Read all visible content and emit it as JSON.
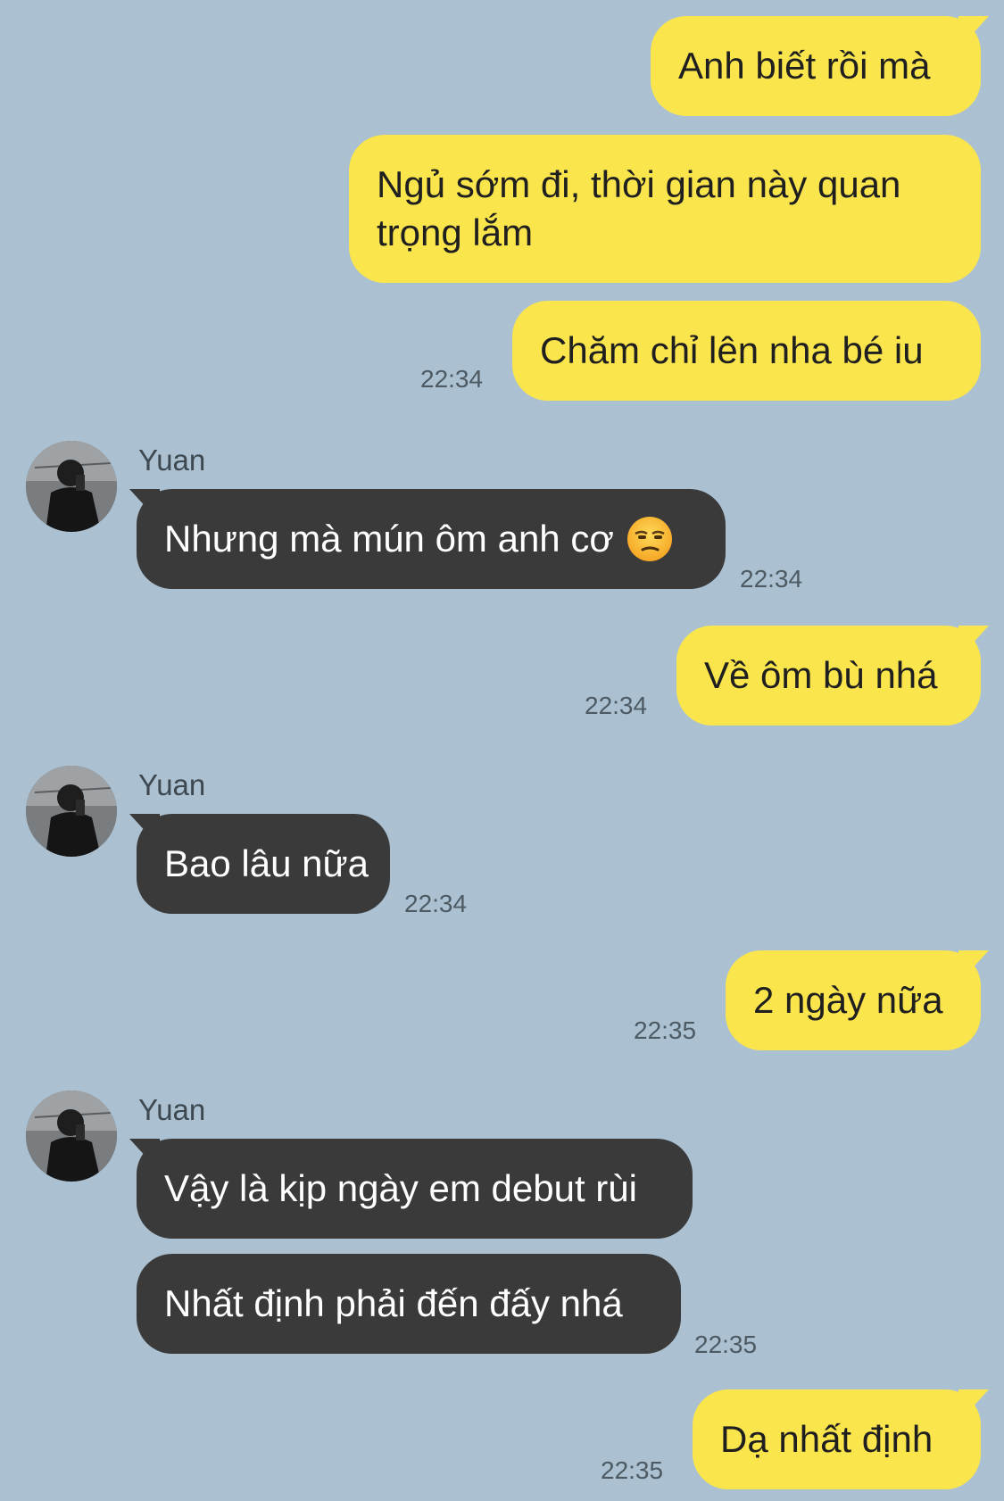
{
  "messages": [
    {
      "text": "Anh biết rồi mà",
      "time": ""
    },
    {
      "text": "Ngủ sớm đi, thời gian này quan trọng lắm",
      "time": ""
    },
    {
      "text": "Chăm chỉ lên nha bé iu",
      "time": "22:34"
    },
    {
      "sender": "Yuan",
      "text": "Nhưng mà mún ôm anh cơ",
      "emoji": "unamused-face-icon",
      "time": "22:34"
    },
    {
      "text": "Về ôm bù nhá",
      "time": "22:34"
    },
    {
      "sender": "Yuan",
      "text": "Bao lâu nữa",
      "time": "22:34"
    },
    {
      "text": "2 ngày nữa",
      "time": "22:35"
    },
    {
      "sender": "Yuan",
      "text": "Vậy là kịp ngày em debut rùi",
      "time": ""
    },
    {
      "sender": "Yuan",
      "text": "Nhất định phải đến đấy nhá",
      "time": "22:35"
    },
    {
      "text": "Dạ nhất định",
      "time": "22:35"
    }
  ],
  "colors": {
    "background": "#abc1d1",
    "outgoing_bubble": "#fae54d",
    "incoming_bubble": "#3a3a3b",
    "timestamp": "#4d5a63"
  },
  "icons": {
    "avatar": "avatar-photo",
    "emoji": "unamused-face-icon"
  }
}
